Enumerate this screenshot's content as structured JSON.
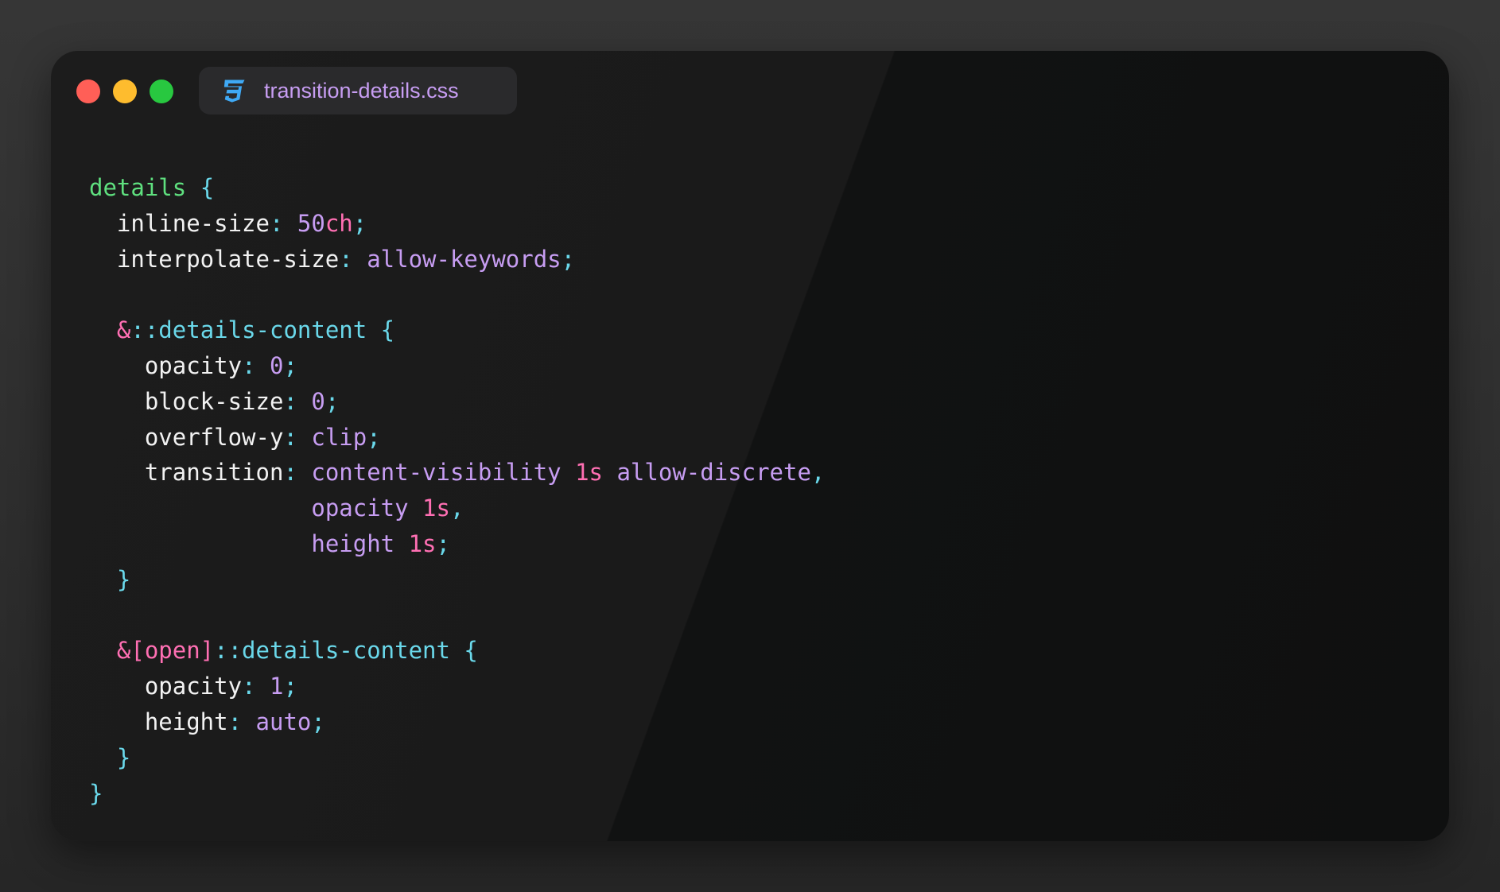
{
  "window": {
    "traffic_lights": [
      {
        "name": "close-button",
        "color": "#ff5f57"
      },
      {
        "name": "minimize-button",
        "color": "#febc2e"
      },
      {
        "name": "zoom-button",
        "color": "#28c840"
      }
    ]
  },
  "tab": {
    "icon": "css3-icon",
    "icon_color": "#3fa9f5",
    "filename": "transition-details.css"
  },
  "colors": {
    "selector": "#5fe07f",
    "brace": "#6ad8ea",
    "property": "#f2f2f2",
    "punct": "#6ad8ea",
    "value": "#c79df2",
    "unit": "#ff6fb3",
    "amp": "#ff6fb3",
    "pseudo": "#6ad8ea"
  },
  "code_lines": [
    {
      "tokens": [
        {
          "t": "details",
          "c": "selector"
        },
        {
          "t": " ",
          "c": "property"
        },
        {
          "t": "{",
          "c": "brace"
        }
      ]
    },
    {
      "tokens": [
        {
          "t": "  inline-size",
          "c": "property"
        },
        {
          "t": ": ",
          "c": "punct"
        },
        {
          "t": "50",
          "c": "value"
        },
        {
          "t": "ch",
          "c": "unit"
        },
        {
          "t": ";",
          "c": "punct"
        }
      ]
    },
    {
      "tokens": [
        {
          "t": "  interpolate-size",
          "c": "property"
        },
        {
          "t": ": ",
          "c": "punct"
        },
        {
          "t": "allow-keywords",
          "c": "value"
        },
        {
          "t": ";",
          "c": "punct"
        }
      ]
    },
    {
      "tokens": []
    },
    {
      "tokens": [
        {
          "t": "  &",
          "c": "amp"
        },
        {
          "t": "::details-content",
          "c": "pseudo"
        },
        {
          "t": " {",
          "c": "brace"
        }
      ]
    },
    {
      "tokens": [
        {
          "t": "    opacity",
          "c": "property"
        },
        {
          "t": ": ",
          "c": "punct"
        },
        {
          "t": "0",
          "c": "value"
        },
        {
          "t": ";",
          "c": "punct"
        }
      ]
    },
    {
      "tokens": [
        {
          "t": "    block-size",
          "c": "property"
        },
        {
          "t": ": ",
          "c": "punct"
        },
        {
          "t": "0",
          "c": "value"
        },
        {
          "t": ";",
          "c": "punct"
        }
      ]
    },
    {
      "tokens": [
        {
          "t": "    overflow-y",
          "c": "property"
        },
        {
          "t": ": ",
          "c": "punct"
        },
        {
          "t": "clip",
          "c": "value"
        },
        {
          "t": ";",
          "c": "punct"
        }
      ]
    },
    {
      "tokens": [
        {
          "t": "    transition",
          "c": "property"
        },
        {
          "t": ": ",
          "c": "punct"
        },
        {
          "t": "content-visibility ",
          "c": "value"
        },
        {
          "t": "1s",
          "c": "unit"
        },
        {
          "t": " allow-discrete",
          "c": "value"
        },
        {
          "t": ",",
          "c": "punct"
        }
      ]
    },
    {
      "tokens": [
        {
          "t": "                ",
          "c": "property"
        },
        {
          "t": "opacity ",
          "c": "value"
        },
        {
          "t": "1s",
          "c": "unit"
        },
        {
          "t": ",",
          "c": "punct"
        }
      ]
    },
    {
      "tokens": [
        {
          "t": "                ",
          "c": "property"
        },
        {
          "t": "height ",
          "c": "value"
        },
        {
          "t": "1s",
          "c": "unit"
        },
        {
          "t": ";",
          "c": "punct"
        }
      ]
    },
    {
      "tokens": [
        {
          "t": "  }",
          "c": "brace"
        }
      ]
    },
    {
      "tokens": []
    },
    {
      "tokens": [
        {
          "t": "  &[open]",
          "c": "amp"
        },
        {
          "t": "::details-content",
          "c": "pseudo"
        },
        {
          "t": " {",
          "c": "brace"
        }
      ]
    },
    {
      "tokens": [
        {
          "t": "    opacity",
          "c": "property"
        },
        {
          "t": ": ",
          "c": "punct"
        },
        {
          "t": "1",
          "c": "value"
        },
        {
          "t": ";",
          "c": "punct"
        }
      ]
    },
    {
      "tokens": [
        {
          "t": "    height",
          "c": "property"
        },
        {
          "t": ": ",
          "c": "punct"
        },
        {
          "t": "auto",
          "c": "value"
        },
        {
          "t": ";",
          "c": "punct"
        }
      ]
    },
    {
      "tokens": [
        {
          "t": "  }",
          "c": "brace"
        }
      ]
    },
    {
      "tokens": [
        {
          "t": "}",
          "c": "brace"
        }
      ]
    }
  ]
}
